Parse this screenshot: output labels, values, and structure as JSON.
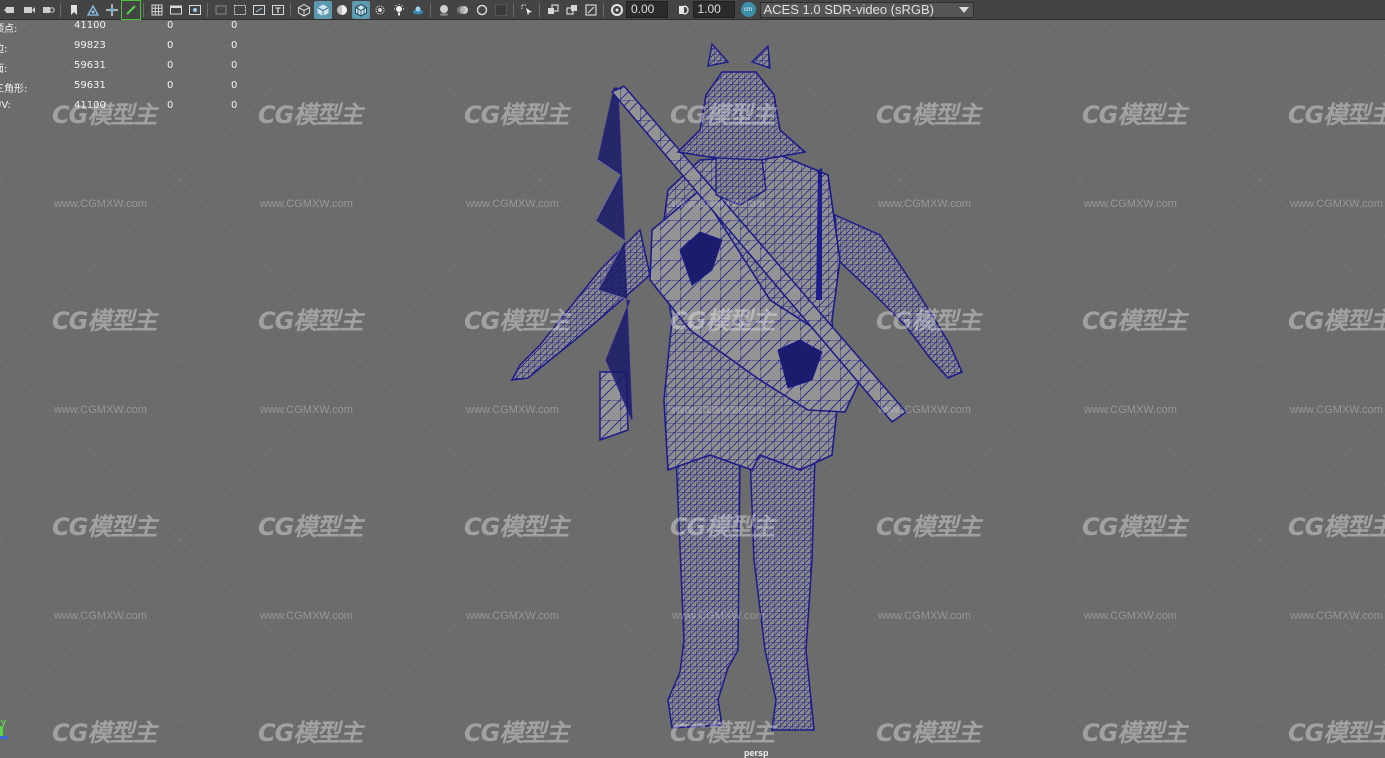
{
  "toolbar": {
    "exposure_value": "0.00",
    "gamma_value": "1.00",
    "colorspace_badge": "cm",
    "colorspace_value": "ACES 1.0 SDR-video (sRGB)",
    "icons": [
      "camera-prev-icon",
      "camera-icon",
      "camera-rotate-icon",
      "bookmark-icon",
      "camera-pin-icon",
      "move-camera-icon",
      "grease-pencil-icon",
      "grid-icon",
      "film-gate-icon",
      "resolution-gate-icon",
      "safe-area-icon",
      "field-chart-icon",
      "safe-action-icon",
      "safe-title-icon",
      "wireframe-cube-icon",
      "smooth-shade-cube-icon",
      "textured-icon",
      "wireframe-on-shaded-icon",
      "use-all-lights-icon",
      "shadows-icon",
      "xray-icon",
      "screen-space-ao-icon",
      "motion-blur-icon",
      "anti-aliasing-icon",
      "depth-of-field-icon",
      "isolate-select-icon",
      "xray-joints-icon",
      "xray-active-icon",
      "backface-icon",
      "exposure-icon",
      "gamma-icon",
      "view-transform-icon"
    ],
    "accent_color": "#5d9ab0",
    "highlight_color": "#49c23a"
  },
  "hud": {
    "rows": [
      {
        "label": "顶点:",
        "v1": "41100",
        "v2": "0",
        "v3": "0"
      },
      {
        "label": "边:",
        "v1": "99823",
        "v2": "0",
        "v3": "0"
      },
      {
        "label": "面:",
        "v1": "59631",
        "v2": "0",
        "v3": "0"
      },
      {
        "label": "三角形:",
        "v1": "59631",
        "v2": "0",
        "v3": "0"
      },
      {
        "label": "UV:",
        "v1": "41100",
        "v2": "0",
        "v3": "0"
      }
    ]
  },
  "viewport": {
    "camera_label": "persp",
    "axis_label": "y",
    "background_color": "#6c6c6c",
    "wireframe_color": "#1c1c8a"
  },
  "watermark": {
    "logo_text": "CG模型主",
    "url_text": "www.CGMXW.com"
  }
}
